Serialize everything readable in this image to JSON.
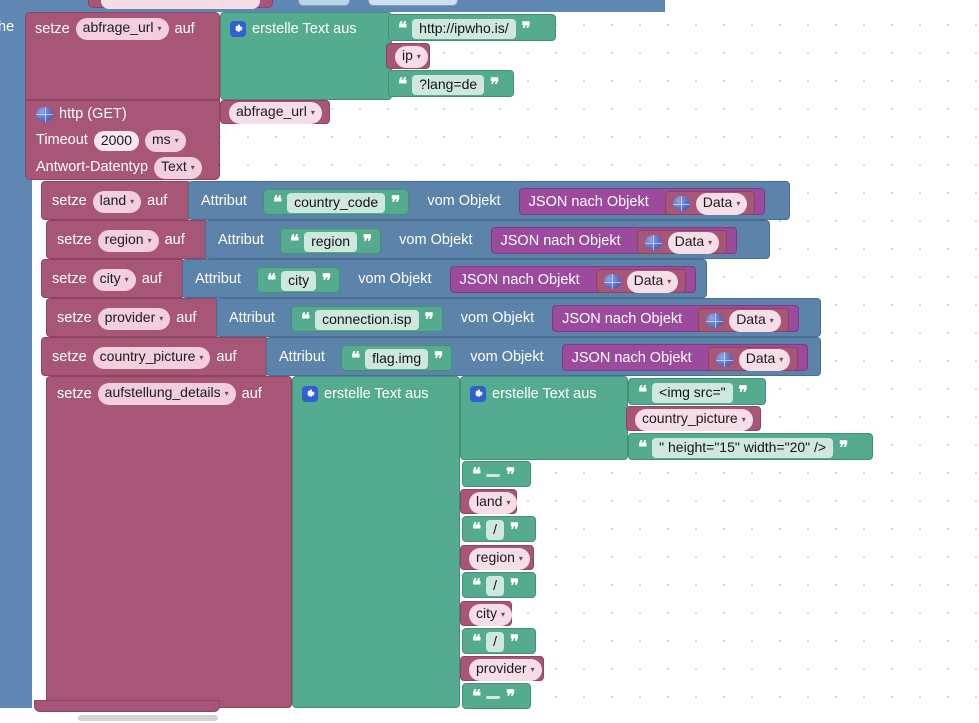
{
  "app": {
    "language": "de",
    "canvas_background": "#ffffff",
    "colors": {
      "variable_block": "#a85678",
      "text_block": "#55ab90",
      "attribute_block": "#5c84aa",
      "json_block": "#9b4a9e",
      "outer_block": "#5f87b4",
      "gear_icon": "#2f5fd0"
    }
  },
  "partial_left_text": "he",
  "blocks": {
    "set_abfrage_url": {
      "keyword": "setze",
      "variable": "abfrage_url",
      "to": "auf",
      "create_text_label": "erstelle Text aus",
      "items": [
        {
          "type": "text",
          "value": "http://ipwho.is/"
        },
        {
          "type": "variable",
          "value": "ip"
        },
        {
          "type": "text",
          "value": "?lang=de"
        }
      ]
    },
    "http_get": {
      "title": "http (GET)",
      "url_variable": "abfrage_url",
      "timeout_label": "Timeout",
      "timeout_value": "2000",
      "timeout_unit": "ms",
      "response_type_label": "Antwort-Datentyp",
      "response_type_value": "Text"
    },
    "attribute_rows": [
      {
        "keyword": "setze",
        "variable": "land",
        "to": "auf",
        "attribute_label": "Attribut",
        "attribute_key": "country_code",
        "from_label": "vom Objekt",
        "json_label": "JSON nach Objekt",
        "data_value": "Data"
      },
      {
        "keyword": "setze",
        "variable": "region",
        "to": "auf",
        "attribute_label": "Attribut",
        "attribute_key": "region",
        "from_label": "vom Objekt",
        "json_label": "JSON nach Objekt",
        "data_value": "Data"
      },
      {
        "keyword": "setze",
        "variable": "city",
        "to": "auf",
        "attribute_label": "Attribut",
        "attribute_key": "city",
        "from_label": "vom Objekt",
        "json_label": "JSON nach Objekt",
        "data_value": "Data"
      },
      {
        "keyword": "setze",
        "variable": "provider",
        "to": "auf",
        "attribute_label": "Attribut",
        "attribute_key": "connection.isp",
        "from_label": "vom Objekt",
        "json_label": "JSON nach Objekt",
        "data_value": "Data"
      },
      {
        "keyword": "setze",
        "variable": "country_picture",
        "to": "auf",
        "attribute_label": "Attribut",
        "attribute_key": "flag.img",
        "from_label": "vom Objekt",
        "json_label": "JSON nach Objekt",
        "data_value": "Data"
      }
    ],
    "set_aufstellung_details": {
      "keyword": "setze",
      "variable": "aufstellung_details",
      "to": "auf",
      "create_text_label": "erstelle Text aus",
      "inner_create_text_label": "erstelle Text aus",
      "inner_items": [
        {
          "type": "text",
          "value": "<img src=\""
        },
        {
          "type": "variable",
          "value": "country_picture"
        },
        {
          "type": "text",
          "value": "\" height=\"15\" width=\"20\" />"
        }
      ],
      "outer_items": [
        {
          "type": "text",
          "value": " "
        },
        {
          "type": "variable",
          "value": "land"
        },
        {
          "type": "text",
          "value": "/"
        },
        {
          "type": "variable",
          "value": "region"
        },
        {
          "type": "text",
          "value": "/"
        },
        {
          "type": "variable",
          "value": "city"
        },
        {
          "type": "text",
          "value": "/"
        },
        {
          "type": "variable",
          "value": "provider"
        },
        {
          "type": "text",
          "value": " "
        }
      ]
    }
  },
  "icons": {
    "gear": "gear-icon",
    "globe": "globe-icon",
    "caret": "▾",
    "quote_open": "❝",
    "quote_close": "❞"
  }
}
